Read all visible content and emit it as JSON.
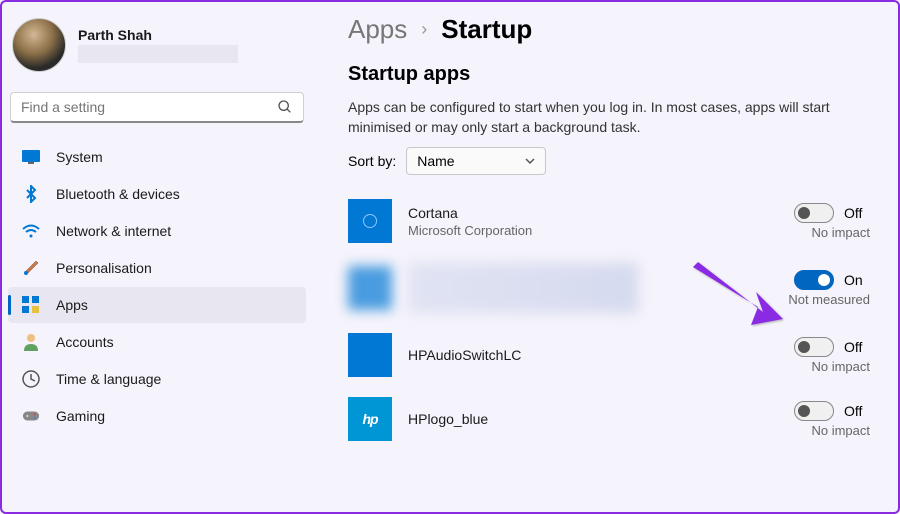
{
  "profile": {
    "name": "Parth Shah"
  },
  "search": {
    "placeholder": "Find a setting"
  },
  "nav": {
    "items": [
      {
        "label": "System"
      },
      {
        "label": "Bluetooth & devices"
      },
      {
        "label": "Network & internet"
      },
      {
        "label": "Personalisation"
      },
      {
        "label": "Apps"
      },
      {
        "label": "Accounts"
      },
      {
        "label": "Time & language"
      },
      {
        "label": "Gaming"
      }
    ]
  },
  "breadcrumb": {
    "parent": "Apps",
    "separator": "›",
    "current": "Startup"
  },
  "page": {
    "title": "Startup apps",
    "description": "Apps can be configured to start when you log in. In most cases, apps will start minimised or may only start a background task.",
    "sort_label": "Sort by:",
    "sort_value": "Name"
  },
  "apps": [
    {
      "name": "Cortana",
      "publisher": "Microsoft Corporation",
      "toggle": "Off",
      "impact": "No impact"
    },
    {
      "name": "",
      "publisher": "",
      "toggle": "On",
      "impact": "Not measured"
    },
    {
      "name": "HPAudioSwitchLC",
      "publisher": "",
      "toggle": "Off",
      "impact": "No impact"
    },
    {
      "name": "HPlogo_blue",
      "publisher": "",
      "toggle": "Off",
      "impact": "No impact"
    }
  ]
}
